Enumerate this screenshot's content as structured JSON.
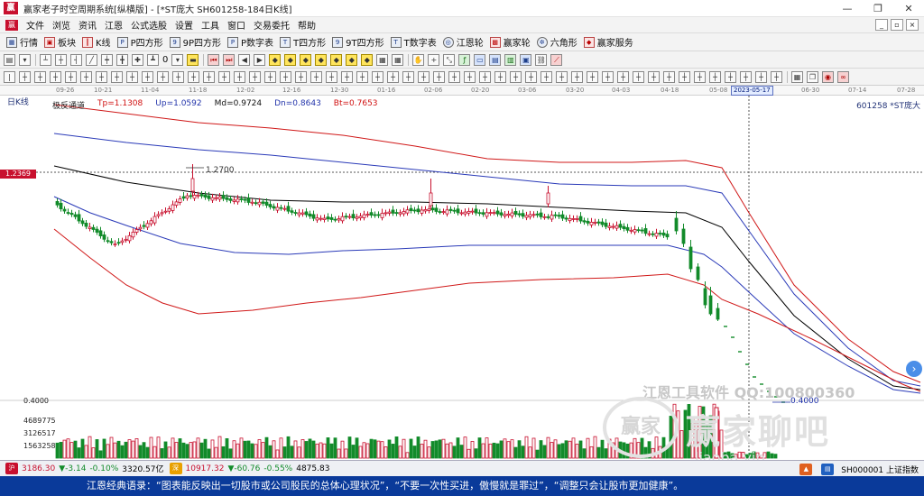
{
  "window": {
    "title": "赢家老子时空周期系统[纵横版] - [*ST庞大  SH601258-184日K线]",
    "controls": [
      "—",
      "❐",
      "✕"
    ]
  },
  "menu": {
    "items": [
      "文件",
      "浏览",
      "资讯",
      "江恩",
      "公式选股",
      "设置",
      "工具",
      "窗口",
      "交易委托",
      "帮助"
    ],
    "right_buttons": [
      "_",
      "▫",
      "×"
    ]
  },
  "toolbar": {
    "items": [
      {
        "label": "行情",
        "icon": "grid-icon"
      },
      {
        "label": "板块",
        "icon": "blocks-icon"
      },
      {
        "label": "K线",
        "icon": "candles-icon"
      },
      {
        "label": "P四方形",
        "icon": "square-p-icon"
      },
      {
        "label": "9P四方形",
        "icon": "square-9p-icon"
      },
      {
        "label": "P数字表",
        "icon": "table-p-icon"
      },
      {
        "label": "T四方形",
        "icon": "square-t-icon"
      },
      {
        "label": "9T四方形",
        "icon": "square-9t-icon"
      },
      {
        "label": "T数字表",
        "icon": "table-t-icon"
      },
      {
        "label": "江恩轮",
        "icon": "wheel-icon"
      },
      {
        "label": "赢家轮",
        "icon": "wheel-win-icon"
      },
      {
        "label": "六角形",
        "icon": "hexagon-icon"
      },
      {
        "label": "赢家服务",
        "icon": "service-icon"
      }
    ],
    "digit_label": "0"
  },
  "ruler": {
    "dates": [
      "09-26",
      "10-21",
      "11-04",
      "11-18",
      "12-02",
      "12-16",
      "12-30",
      "01-16",
      "02-06",
      "02-20",
      "03-06",
      "03-20",
      "04-03",
      "04-18",
      "05-08",
      "06-30",
      "07-14",
      "07-28"
    ],
    "current": "2023-05-17"
  },
  "chart": {
    "period": "日K线",
    "indicator": "极反通道",
    "tp": "Tp=1.1308",
    "up": "Up=1.0592",
    "md": "Md=0.9724",
    "dn": "Dn=0.8643",
    "bt": "Bt=0.7653",
    "stock": "601258 *ST庞大",
    "price_tag": "1.2369",
    "high_label": "1.2700",
    "low_label": "0.4000",
    "volume_scale": [
      "0.4000",
      "4689775",
      "3126517",
      "1563258"
    ]
  },
  "watermark": {
    "line": "江恩工具软件  QQ:100800360",
    "logo": "赢家",
    "brand": "赢家聊吧",
    "url": "liaoba.vip"
  },
  "statusbar": {
    "sh_value": "3186.30",
    "sh_change": "▼-3.14",
    "sh_pct": "-0.10%",
    "sh_amount": "3320.57亿",
    "sz_value": "10917.32",
    "sz_change": "▼-60.76",
    "sz_pct": "-0.55%",
    "sz_amount": "4875.83",
    "right_text": "SH000001 上证指数"
  },
  "quote": {
    "text": "江恩经典语录：“图表能反映出一切股市或公司股民的总体心理状况”，“不要一次性买进，傲慢就是罪过”，“调整只会让股市更加健康”。"
  },
  "colors": {
    "up_candle": "#c8102e",
    "down_candle": "#128b2a",
    "outer_band": "#d01818",
    "inner_band": "#2a3ab8",
    "mid_line": "#000000",
    "quote_bg": "#0a3a9a"
  }
}
